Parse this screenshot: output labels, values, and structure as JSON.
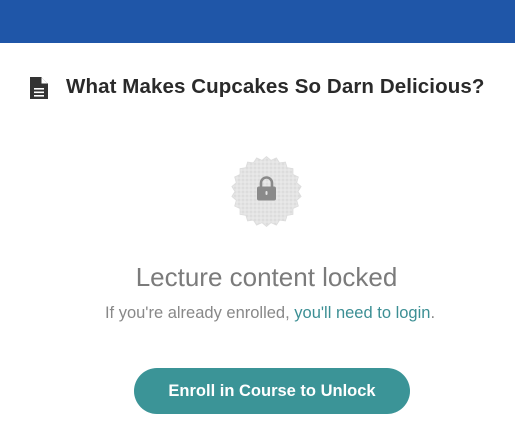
{
  "lecture": {
    "title": "What Makes Cupcakes So Darn Delicious?"
  },
  "locked": {
    "heading": "Lecture content locked",
    "note_prefix": "If you're already enrolled, ",
    "login_link": "you'll need to login",
    "note_suffix": "."
  },
  "actions": {
    "enroll_label": "Enroll in Course to Unlock"
  },
  "icons": {
    "title_icon": "document-icon",
    "badge_icon": "lock-icon"
  },
  "colors": {
    "header_bar": "#1f56a8",
    "accent": "#3b9497",
    "link": "#3c8f94"
  }
}
